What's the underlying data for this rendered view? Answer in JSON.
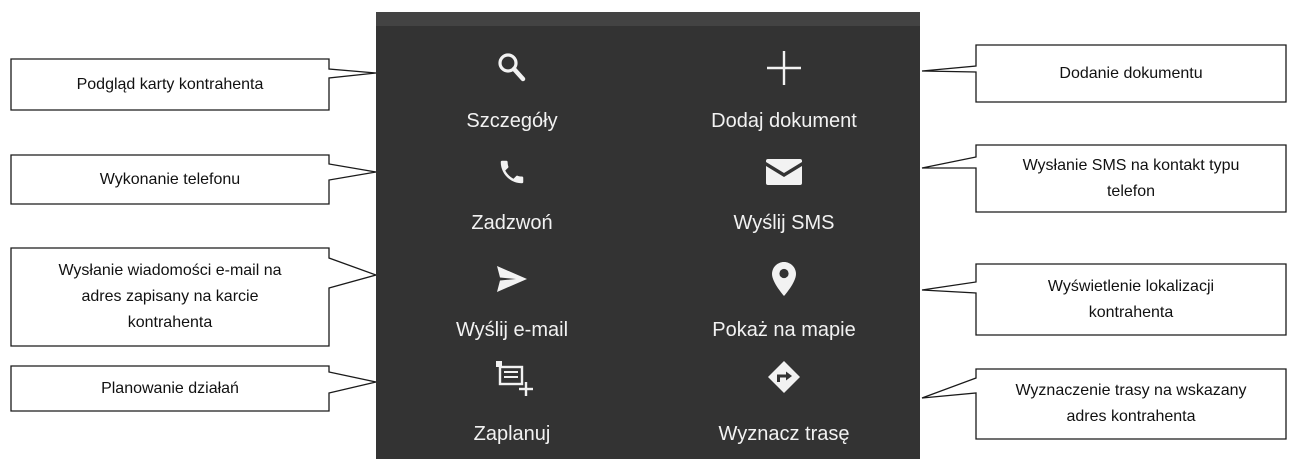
{
  "colors": {
    "panel_bg": "#333333",
    "panel_topbar": "#434343",
    "icon": "#f2f2f2",
    "label": "#f2f2f2",
    "callout_border": "#1a1a1a"
  },
  "menu": {
    "items": [
      {
        "label": "Szczegóły",
        "icon": "search-icon"
      },
      {
        "label": "Dodaj dokument",
        "icon": "plus-icon"
      },
      {
        "label": "Zadzwoń",
        "icon": "phone-icon"
      },
      {
        "label": "Wyślij SMS",
        "icon": "envelope-icon"
      },
      {
        "label": "Wyślij e-mail",
        "icon": "send-icon"
      },
      {
        "label": "Pokaż na mapie",
        "icon": "map-pin-icon"
      },
      {
        "label": "Zaplanuj",
        "icon": "schedule-add-icon"
      },
      {
        "label": "Wyznacz trasę",
        "icon": "directions-icon"
      }
    ]
  },
  "callouts": {
    "details": {
      "lines": [
        "Podgląd karty kontrahenta"
      ]
    },
    "add_document": {
      "lines": [
        "Dodanie dokumentu"
      ]
    },
    "call": {
      "lines": [
        "Wykonanie telefonu"
      ]
    },
    "sms": {
      "lines": [
        "Wysłanie SMS na kontakt typu",
        "telefon"
      ]
    },
    "email": {
      "lines": [
        "Wysłanie wiadomości e-mail na",
        "adres zapisany na karcie",
        "kontrahenta"
      ]
    },
    "map": {
      "lines": [
        "Wyświetlenie lokalizacji",
        "kontrahenta"
      ]
    },
    "plan": {
      "lines": [
        "Planowanie działań"
      ]
    },
    "route": {
      "lines": [
        "Wyznaczenie trasy na wskazany",
        "adres kontrahenta"
      ]
    }
  }
}
